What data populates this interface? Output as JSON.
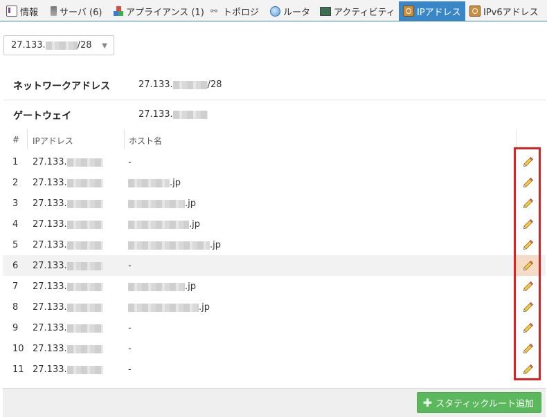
{
  "tabs": [
    {
      "label": "情報",
      "icon": "info-icon"
    },
    {
      "label": "サーバ (6)",
      "icon": "server-icon"
    },
    {
      "label": "アプライアンス (1)",
      "icon": "appliance-icon"
    },
    {
      "label": "トポロジ",
      "icon": "topology-icon"
    },
    {
      "label": "ルータ",
      "icon": "globe-icon"
    },
    {
      "label": "アクティビティ",
      "icon": "monitor-icon"
    },
    {
      "label": "IPアドレス",
      "icon": "address-book-icon",
      "active": true
    },
    {
      "label": "IPv6アドレス",
      "icon": "address-book-icon"
    }
  ],
  "subnet_select": {
    "prefix": "27.133.",
    "suffix": "/28"
  },
  "network": {
    "label": "ネットワークアドレス",
    "prefix": "27.133.",
    "suffix": "/28"
  },
  "gateway": {
    "label": "ゲートウェイ",
    "prefix": "27.133."
  },
  "table": {
    "columns": [
      "#",
      "IPアドレス",
      "ホスト名"
    ],
    "rows": [
      {
        "num": "1",
        "ip_prefix": "27.133.",
        "host_suffix": "-"
      },
      {
        "num": "2",
        "ip_prefix": "27.133.",
        "host_suffix": ".jp"
      },
      {
        "num": "3",
        "ip_prefix": "27.133.",
        "host_suffix": ".jp"
      },
      {
        "num": "4",
        "ip_prefix": "27.133.",
        "host_suffix": ".jp"
      },
      {
        "num": "5",
        "ip_prefix": "27.133.",
        "host_suffix": ".jp"
      },
      {
        "num": "6",
        "ip_prefix": "27.133.",
        "host_suffix": "-"
      },
      {
        "num": "7",
        "ip_prefix": "27.133.",
        "host_suffix": ".jp"
      },
      {
        "num": "8",
        "ip_prefix": "27.133.",
        "host_suffix": ".jp"
      },
      {
        "num": "9",
        "ip_prefix": "27.133.",
        "host_suffix": "-"
      },
      {
        "num": "10",
        "ip_prefix": "27.133.",
        "host_suffix": "-"
      },
      {
        "num": "11",
        "ip_prefix": "27.133.",
        "host_suffix": "-"
      }
    ]
  },
  "footer": {
    "add_button_label": "スタティックルート追加"
  },
  "colors": {
    "accent": "#3a87c8",
    "button_green": "#5cb85c",
    "highlight_red": "#e02020"
  }
}
